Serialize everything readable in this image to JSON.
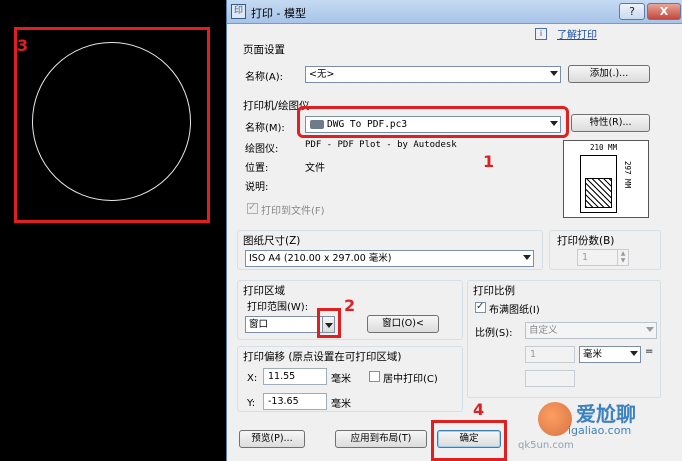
{
  "cad": {
    "annotation": "3"
  },
  "window": {
    "title": "打印 - 模型",
    "icon_label": "印",
    "help_button": "?",
    "close_button": "X"
  },
  "help_link": {
    "icon": "i",
    "text": "了解打印"
  },
  "page_setup": {
    "section": "页面设置",
    "name_label": "名称(A):",
    "name_value": "<无>",
    "add_button": "添加(.)..."
  },
  "printer": {
    "section": "打印机/绘图仪",
    "name_label": "名称(M):",
    "name_value": "DWG To PDF.pc3",
    "properties_button": "特性(R)...",
    "plotter_label": "绘图仪:",
    "plotter_value": "PDF - PDF Plot - by Autodesk",
    "location_label": "位置:",
    "location_value": "文件",
    "description_label": "说明:",
    "print_to_file": "打印到文件(F)",
    "annotation": "1",
    "preview_width": "210 MM",
    "preview_height": "297 MM"
  },
  "paper": {
    "section": "图纸尺寸(Z)",
    "value": "ISO A4 (210.00 x 297.00 毫米)"
  },
  "copies": {
    "section": "打印份数(B)",
    "value": "1"
  },
  "plot_area": {
    "section": "打印区域",
    "range_label": "打印范围(W):",
    "range_value": "窗口",
    "window_button": "窗口(O)<",
    "annotation": "2"
  },
  "scale": {
    "section": "打印比例",
    "fit_label": "布满图纸(I)",
    "ratio_label": "比例(S):",
    "ratio_value": "自定义",
    "value1": "1",
    "unit1": "毫米",
    "eq": "="
  },
  "offset": {
    "section": "打印偏移 (原点设置在可打印区域)",
    "x_label": "X:",
    "x_value": "11.55",
    "x_unit": "毫米",
    "center_label": "居中打印(C)",
    "y_label": "Y:",
    "y_value": "-13.65",
    "y_unit": "毫米"
  },
  "footer": {
    "preview_button": "预览(P)...",
    "apply_button": "应用到布局(T)",
    "ok_button": "确定",
    "annotation": "4"
  },
  "watermark": {
    "text": "爱尬聊",
    "url": "igaliao.com",
    "corner": "qk5un.com"
  },
  "colors": {
    "annotation_red": "#e02020",
    "title_bar": "#b8d0ee",
    "dialog_bg": "#f0f0f0"
  }
}
